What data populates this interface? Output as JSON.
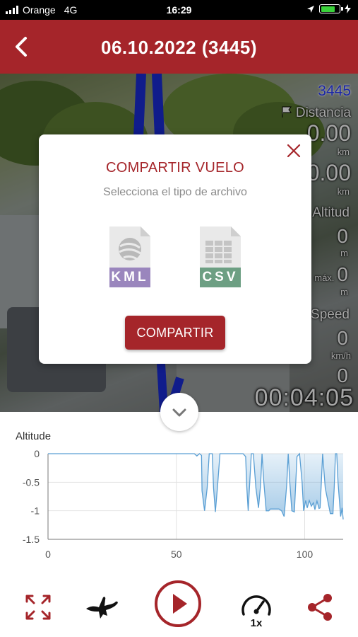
{
  "status_bar": {
    "carrier": "Orange",
    "network": "4G",
    "time": "16:29"
  },
  "header": {
    "title": "06.10.2022 (3445)"
  },
  "stats": {
    "flight_id": "3445",
    "distance_label": "Distancia",
    "distance_value_1": "0.00",
    "distance_unit_1": "km",
    "distance_value_2": "0.00",
    "distance_unit_2": "km",
    "altitude_label": "Altitud",
    "altitude_value": "0",
    "altitude_unit": "m",
    "max_label": "máx.",
    "max_value": "0",
    "max_unit": "m",
    "speed_label": "Speed",
    "speed_value": "0",
    "speed_unit": "km/h",
    "extra_value": "0",
    "duration": "00:04:05"
  },
  "dialog": {
    "title": "COMPARTIR VUELO",
    "subtitle": "Selecciona el tipo de archivo",
    "kml_label": "KML",
    "csv_label": "CSV",
    "share_button": "COMPARTIR"
  },
  "chart_data": {
    "type": "area",
    "title": "Altitude",
    "xlabel": "",
    "ylabel": "",
    "xlim": [
      0,
      115
    ],
    "ylim": [
      -1.5,
      0
    ],
    "x_ticks": [
      0,
      50,
      100
    ],
    "x_tick_labels": [
      "0",
      "50",
      "100"
    ],
    "y_ticks": [
      0,
      -0.5,
      -1,
      -1.5
    ],
    "y_tick_labels": [
      "0",
      "-0.5",
      "-1",
      "-1.5"
    ],
    "grid": true,
    "series": [
      {
        "color": "#5a9fd4",
        "x": [
          0,
          56,
          57,
          58,
          59,
          59.8,
          60,
          61,
          62,
          62.8,
          63,
          64,
          64.5,
          65.2,
          66,
          67,
          68,
          70,
          72,
          74,
          76,
          77,
          77.4,
          78,
          78.6,
          79.2,
          80,
          81,
          82,
          82.8,
          83.4,
          84,
          85,
          86,
          86.6,
          87.5,
          89,
          90,
          91,
          92,
          93,
          93.6,
          94.2,
          95,
          96,
          97,
          98,
          99,
          99.6,
          100.4,
          101,
          101.8,
          102.6,
          103.4,
          104,
          104.8,
          105.6,
          106,
          106.5,
          107,
          108,
          110,
          111,
          111.5,
          112,
          112.5,
          113,
          114,
          114.6,
          115
        ],
        "y": [
          0,
          0,
          0,
          -0.04,
          0,
          -0.03,
          -0.65,
          -1.0,
          -0.6,
          0,
          0,
          0,
          -0.6,
          -1.02,
          -0.6,
          0,
          0,
          0,
          0,
          0,
          0,
          -0.05,
          -0.55,
          -1.0,
          -0.5,
          0,
          0,
          -0.6,
          -0.95,
          -0.55,
          0,
          -0.45,
          -1.0,
          -1.0,
          -0.97,
          -0.97,
          -0.97,
          -0.97,
          -1.0,
          -1.1,
          -0.55,
          0,
          -0.5,
          -1.0,
          -1.02,
          -0.05,
          0,
          -0.5,
          -1.0,
          -0.82,
          -0.95,
          -0.82,
          -0.92,
          -0.86,
          -0.98,
          -0.83,
          -0.96,
          -0.95,
          -0.5,
          0,
          -0.6,
          -1.05,
          -1.05,
          -0.6,
          0,
          0,
          -0.5,
          -1.1,
          -0.95,
          -1.15
        ]
      }
    ]
  },
  "toolbar": {
    "speed_multiplier": "1x",
    "accent": "#a5252a"
  }
}
